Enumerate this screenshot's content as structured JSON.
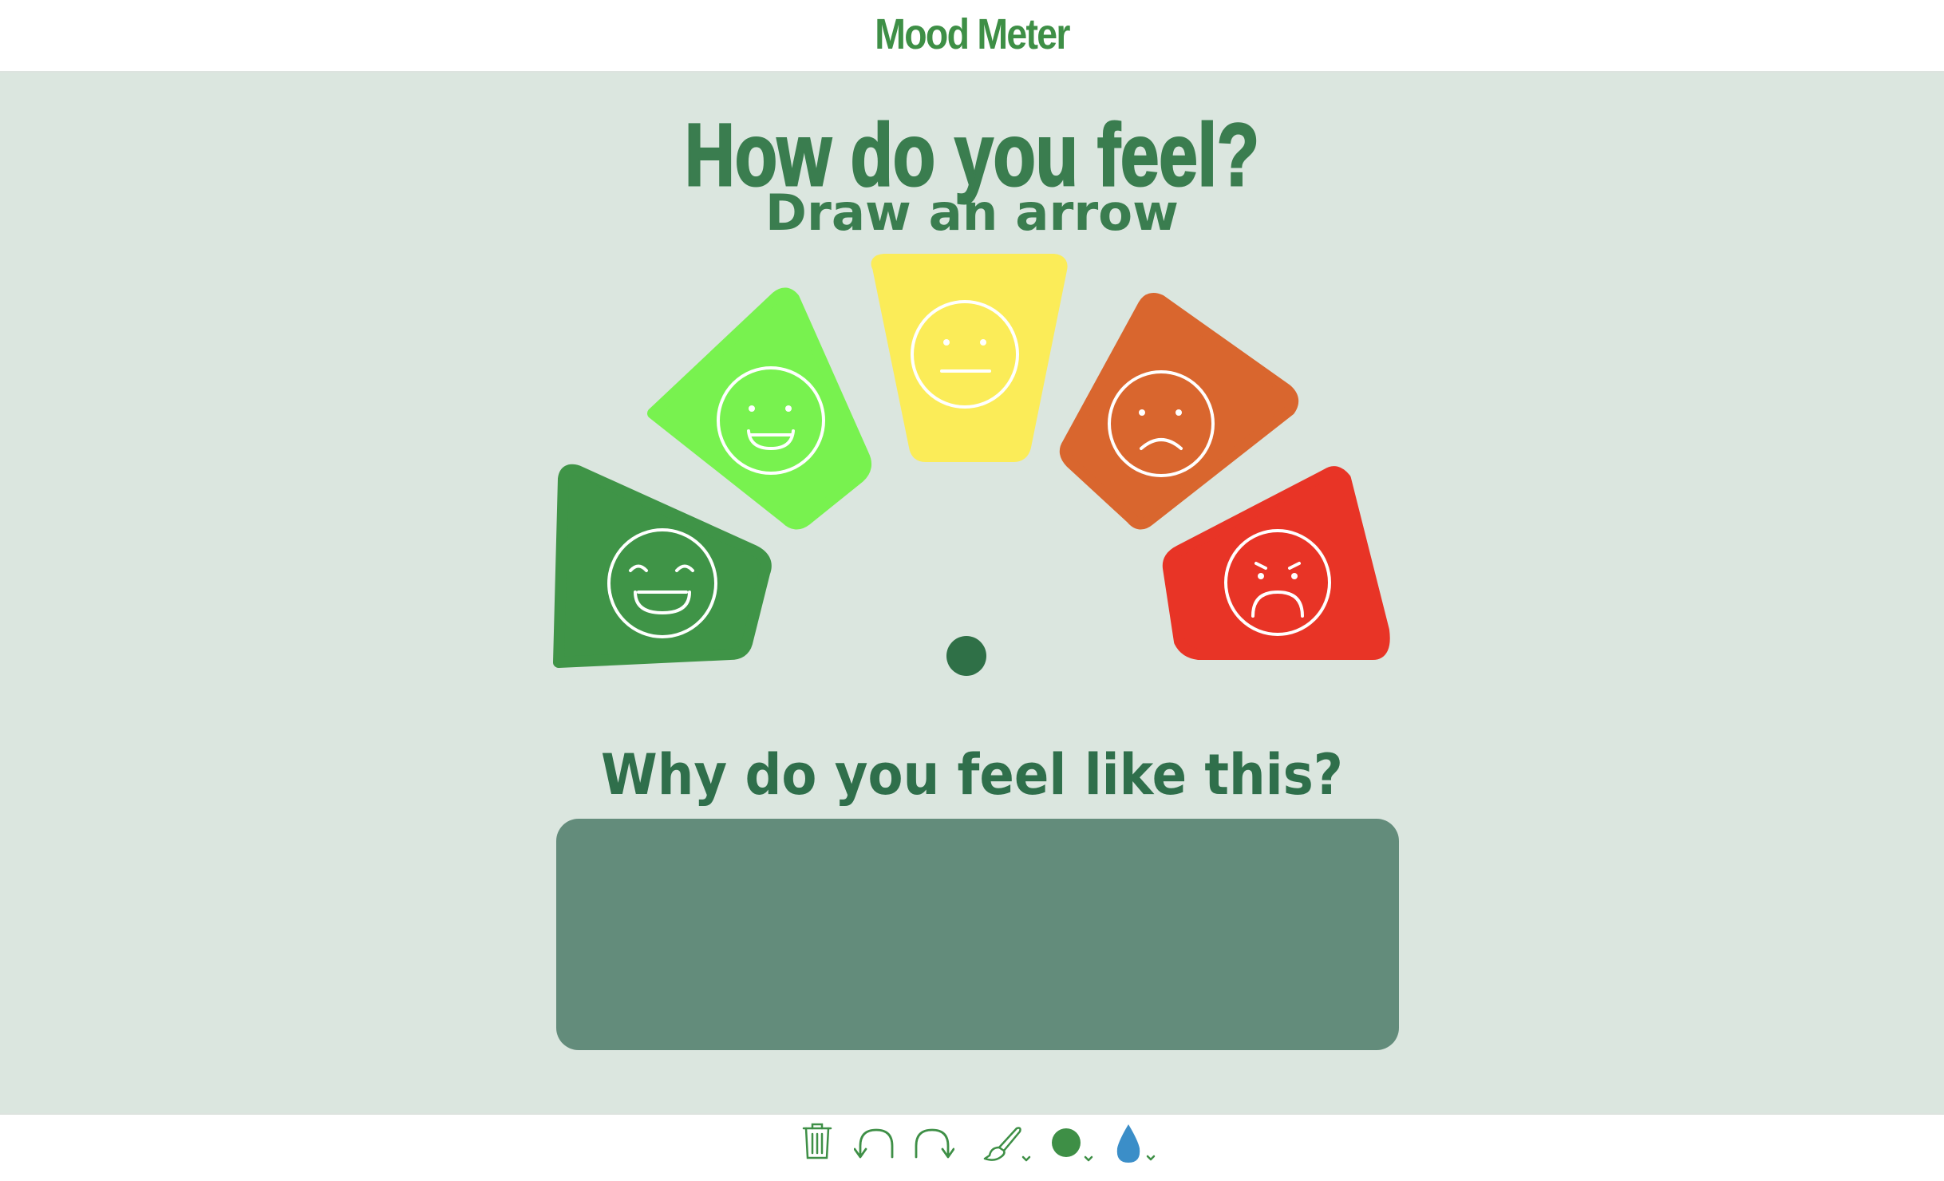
{
  "header": {
    "title": "Mood Meter"
  },
  "worksheet": {
    "heading": "How do you feel?",
    "subheading": "Draw an arrow",
    "question": "Why do you feel like this?",
    "answer_text": "",
    "moods": [
      {
        "face": "very-happy",
        "color": "#3f9447"
      },
      {
        "face": "happy",
        "color": "#78f24f"
      },
      {
        "face": "neutral",
        "color": "#fbec58"
      },
      {
        "face": "sad",
        "color": "#d9662e"
      },
      {
        "face": "very-sad",
        "color": "#e83426"
      }
    ],
    "pivot_color": "#2f7047",
    "answer_box_color": "#638c7b"
  },
  "toolbar": {
    "tools": [
      "trash-icon",
      "undo-icon",
      "redo-icon",
      "brush-icon",
      "color-picker-icon",
      "opacity-icon"
    ],
    "active_color": "#3e8f46",
    "opacity_color": "#3b8ec8"
  }
}
